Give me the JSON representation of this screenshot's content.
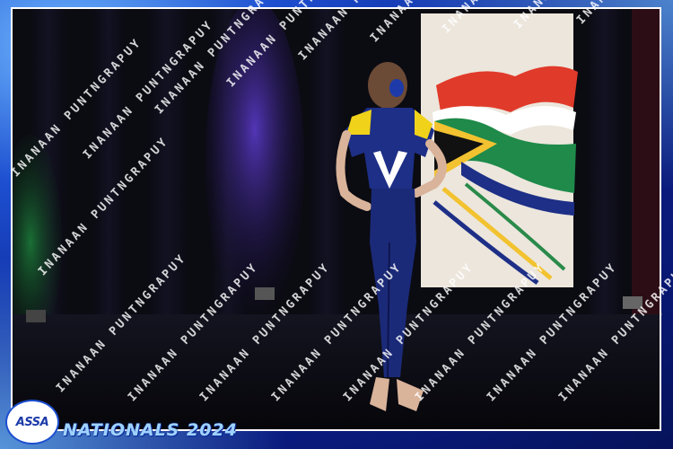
{
  "branding": {
    "logo_text": "ASSA",
    "event_title": "NATIONALS 2024",
    "watermark_text": "INANAAN PUNTNGRAPUY"
  },
  "colors": {
    "frame_blue": "#0b1f8f",
    "accent_gold": "#f2c230",
    "costume_blue": "#1d2f86",
    "costume_yellow": "#f0d21a",
    "flag_red": "#e03a2a",
    "flag_green": "#1f8a4a"
  }
}
